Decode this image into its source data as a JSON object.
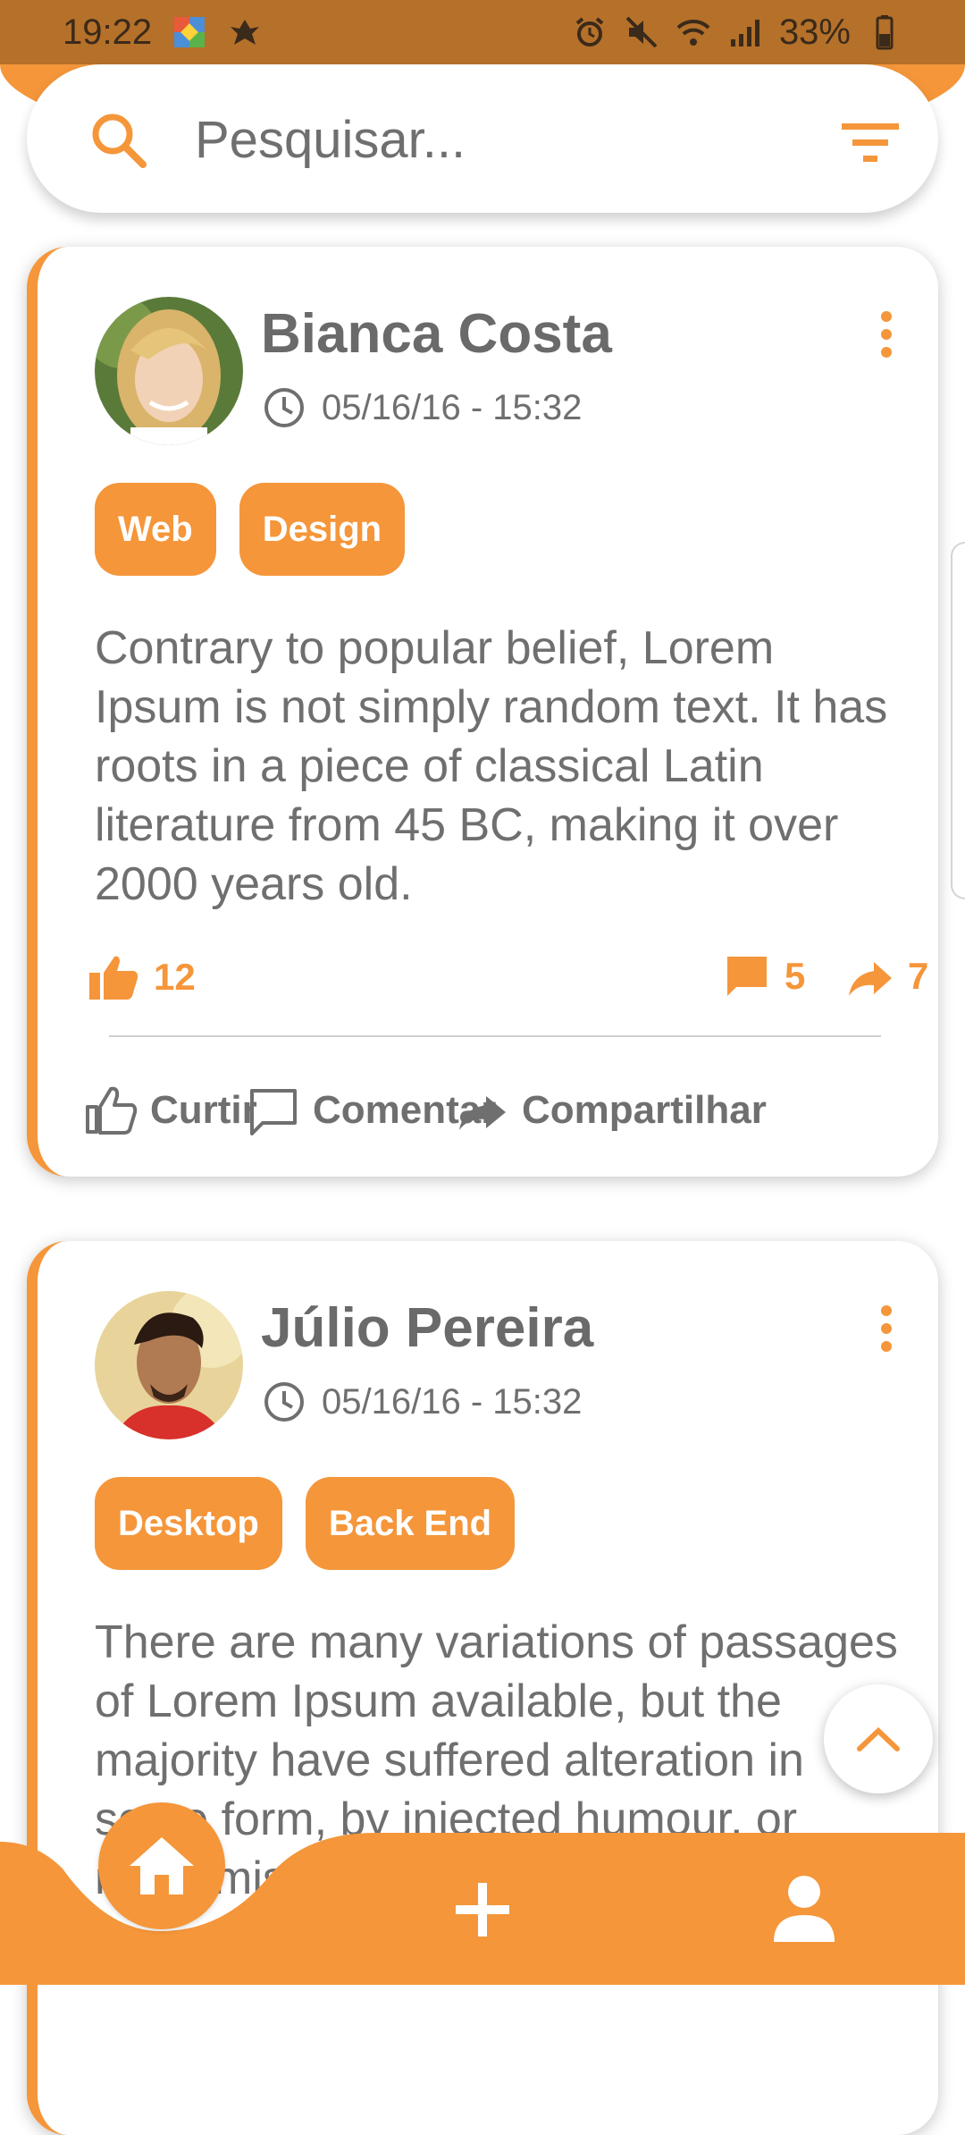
{
  "status_bar": {
    "time": "19:22",
    "battery": "33%"
  },
  "search": {
    "placeholder": "Pesquisar..."
  },
  "posts": [
    {
      "author": "Bianca Costa",
      "datetime": "05/16/16 - 15:32",
      "tags": [
        "Web",
        "Design"
      ],
      "text": "Contrary to popular belief, Lorem Ipsum is not simply random text. It has roots in a piece of classical Latin literature from 45 BC, making it over 2000 years old.",
      "likes": "12",
      "comments": "5",
      "shares": "7"
    },
    {
      "author": "Júlio Pereira",
      "datetime": "05/16/16 - 15:32",
      "tags": [
        "Desktop",
        "Back End"
      ],
      "text": "There are many variations of passages of Lorem Ipsum available, but the majority have suffered alteration in some form, by injected humour, or randomised"
    }
  ],
  "actions": {
    "like": "Curtir",
    "comment": "Comentar",
    "share": "Compartilhar"
  },
  "colors": {
    "accent": "#f5963a",
    "status_bar": "#b5702a",
    "text": "#6f6f6f"
  },
  "icons": {
    "search": "search-icon",
    "filter": "filter-icon",
    "clock": "clock-icon",
    "more": "more-vert-icon",
    "like": "thumb-up-icon",
    "comment": "comment-icon",
    "share": "share-arrow-icon",
    "home": "home-icon",
    "add": "plus-icon",
    "profile": "person-icon",
    "scroll_up": "chevron-up-icon"
  }
}
